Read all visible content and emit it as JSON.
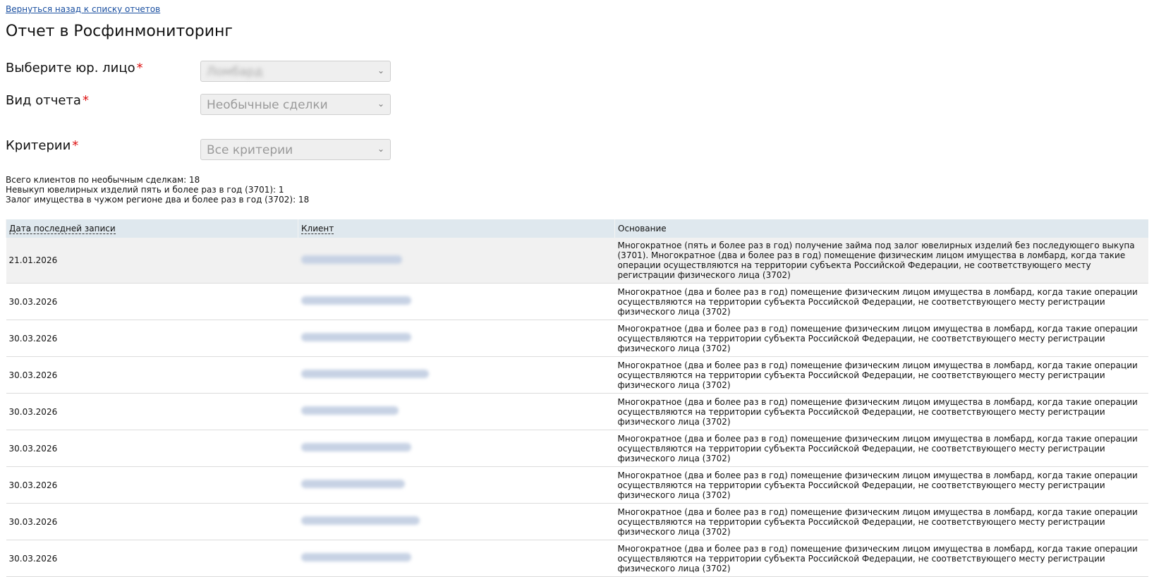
{
  "back_link": "Вернуться назад к списку отчетов",
  "title": "Отчет в Росфинмониторинг",
  "form": {
    "legal_entity": {
      "label": "Выберите юр. лицо",
      "required_mark": "*",
      "value": "Ломбард"
    },
    "report_type": {
      "label": "Вид отчета",
      "required_mark": "*",
      "value": "Необычные сделки"
    },
    "criteria": {
      "label": "Критерии",
      "required_mark": "*",
      "value": "Все критерии"
    }
  },
  "stats": [
    "Всего клиентов по необычным сделкам: 18",
    "Невыкуп ювелирных изделий пять и более раз в год (3701): 1",
    "Залог имущества в чужом регионе два и более раз в год (3702): 18"
  ],
  "table": {
    "headers": {
      "date": "Дата последней записи",
      "client": "Клиент",
      "reason": "Основание"
    },
    "rows": [
      {
        "date": "21.01.2026",
        "client_blur_fraction": 0.33,
        "reason": "Многократное (пять и более раз в год) получение займа под залог ювелирных изделий без последующего выкупа (3701). Многократное (два и более раз в год) помещение физическим лицом имущества в ломбард, когда такие операции осуществляются на территории субъекта Российской Федерации, не соответствующего месту регистрации физического лица (3702)"
      },
      {
        "date": "30.03.2026",
        "client_blur_fraction": 0.36,
        "reason": "Многократное (два и более раз в год) помещение физическим лицом имущества в ломбард, когда такие операции осуществляются на территории субъекта Российской Федерации, не соответствующего месту регистрации физического лица (3702)"
      },
      {
        "date": "30.03.2026",
        "client_blur_fraction": 0.36,
        "reason": "Многократное (два и более раз в год) помещение физическим лицом имущества в ломбард, когда такие операции осуществляются на территории субъекта Российской Федерации, не соответствующего месту регистрации физического лица (3702)"
      },
      {
        "date": "30.03.2026",
        "client_blur_fraction": 0.42,
        "reason": "Многократное (два и более раз в год) помещение физическим лицом имущества в ломбард, когда такие операции осуществляются на территории субъекта Российской Федерации, не соответствующего месту регистрации физического лица (3702)"
      },
      {
        "date": "30.03.2026",
        "client_blur_fraction": 0.32,
        "reason": "Многократное (два и более раз в год) помещение физическим лицом имущества в ломбард, когда такие операции осуществляются на территории субъекта Российской Федерации, не соответствующего месту регистрации физического лица (3702)"
      },
      {
        "date": "30.03.2026",
        "client_blur_fraction": 0.36,
        "reason": "Многократное (два и более раз в год) помещение физическим лицом имущества в ломбард, когда такие операции осуществляются на территории субъекта Российской Федерации, не соответствующего месту регистрации физического лица (3702)"
      },
      {
        "date": "30.03.2026",
        "client_blur_fraction": 0.34,
        "reason": "Многократное (два и более раз в год) помещение физическим лицом имущества в ломбард, когда такие операции осуществляются на территории субъекта Российской Федерации, не соответствующего месту регистрации физического лица (3702)"
      },
      {
        "date": "30.03.2026",
        "client_blur_fraction": 0.39,
        "reason": "Многократное (два и более раз в год) помещение физическим лицом имущества в ломбард, когда такие операции осуществляются на территории субъекта Российской Федерации, не соответствующего месту регистрации физического лица (3702)"
      },
      {
        "date": "30.03.2026",
        "client_blur_fraction": 0.36,
        "reason": "Многократное (два и более раз в год) помещение физическим лицом имущества в ломбард, когда такие операции осуществляются на территории субъекта Российской Федерации, не соответствующего месту регистрации физического лица (3702)"
      }
    ]
  }
}
